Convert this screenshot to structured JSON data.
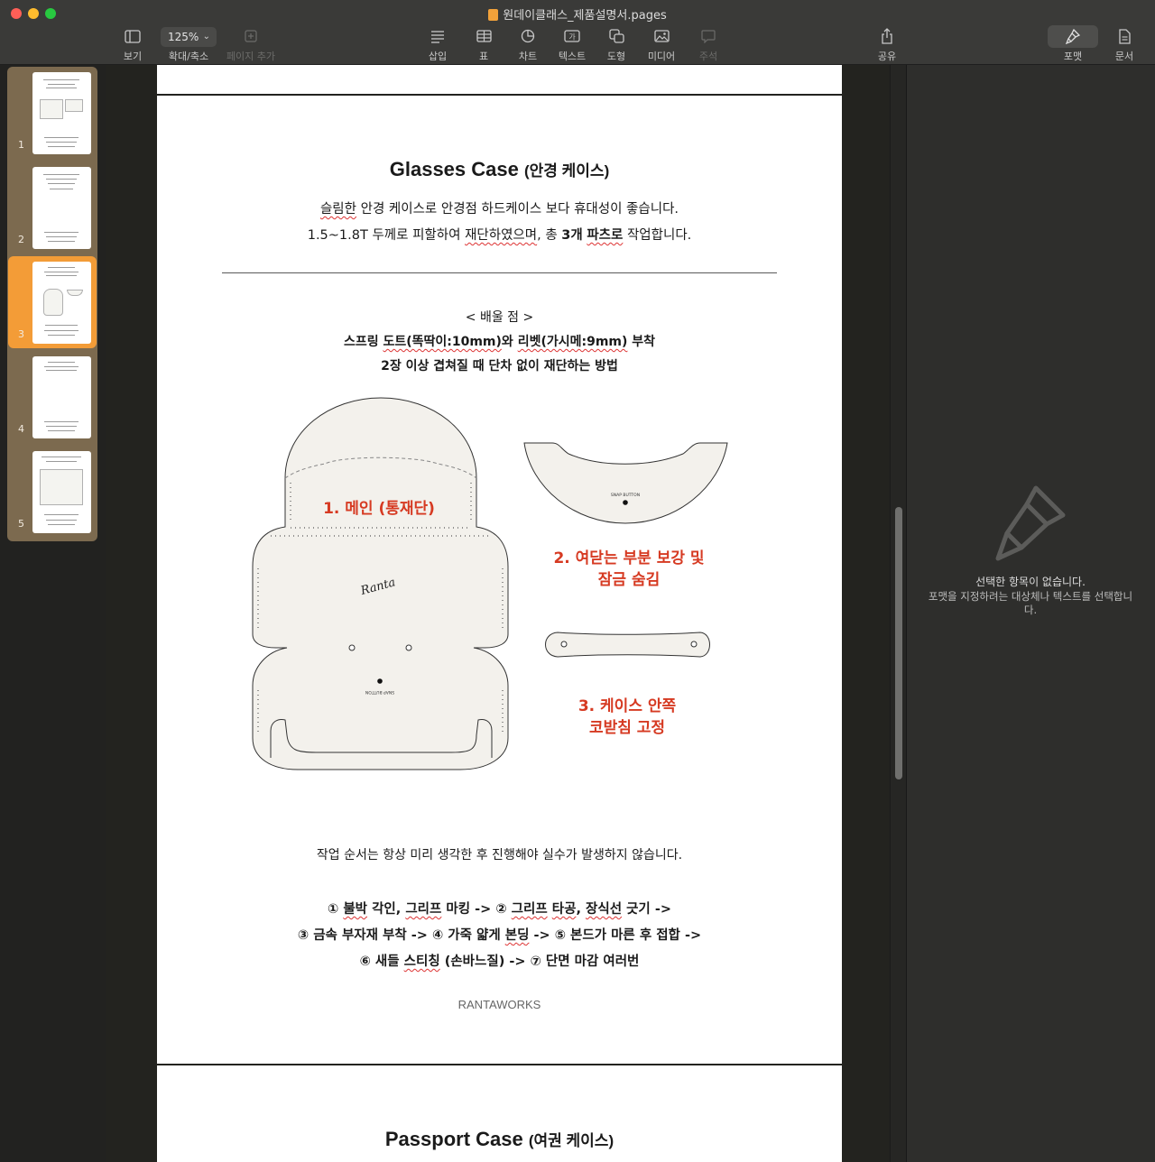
{
  "window": {
    "title": "원데이클래스_제품설명서.pages"
  },
  "toolbar": {
    "view_label": "보기",
    "zoom_value": "125%",
    "zoom_label": "확대/축소",
    "add_page_label": "페이지 추가",
    "insert_label": "삽입",
    "table_label": "표",
    "chart_label": "차트",
    "text_label": "텍스트",
    "shape_label": "도형",
    "media_label": "미디어",
    "comment_label": "주석",
    "share_label": "공유",
    "format_label": "포맷",
    "document_label": "문서"
  },
  "sidebar": {
    "pages": [
      {
        "number": "1"
      },
      {
        "number": "2"
      },
      {
        "number": "3",
        "selected": true
      },
      {
        "number": "4"
      },
      {
        "number": "5"
      }
    ]
  },
  "inspector": {
    "title": "선택한 항목이 없습니다.",
    "subtitle": "포맷을 지정하려는 대상체나 텍스트를 선택합니다."
  },
  "document": {
    "title_en": "Glasses Case",
    "title_ko": "(안경 케이스)",
    "intro_line1_parts": [
      "",
      "슬림한",
      " 안경 케이스로 안경점 하드케이스 보다 휴대성이 좋습니다."
    ],
    "intro_line2_parts": [
      "1.5~1.8T 두께로 피할하여 ",
      "재단하였으며",
      ", 총 ",
      "3개",
      " ",
      "파츠로",
      " 작업합니다."
    ],
    "learn_heading": "< 배울 점 >",
    "learn_line1_parts": [
      "스프링 ",
      "도트(똑딱이:10mm)",
      "와 ",
      "리벳(가시메:9mm)",
      " 부착"
    ],
    "learn_line2": "2장 이상 겹쳐질 때 단차 없이 재단하는 방법",
    "callouts": {
      "main": "1. 메인 (통재단)",
      "reinforce_line1": "2. 여닫는 부분 보강 및",
      "reinforce_line2": "잠금 숨김",
      "nose_line1": "3. 케이스 안쪽",
      "nose_line2": "코받침 고정"
    },
    "pattern_labels": {
      "snap_button": "SNAP BUTTON",
      "logo": "Ranta"
    },
    "order_note": "작업 순서는 항상 미리 생각한 후 진행해야 실수가 발생하지 않습니다.",
    "steps_line1_parts": [
      "① ",
      "불박",
      " 각인, ",
      "그리프",
      " 마킹 -> ② ",
      "그리프",
      " ",
      "타공",
      ", ",
      "장식선",
      " 긋기 ->"
    ],
    "steps_line2_parts": [
      "③ 금속 부자재 부착 -> ④ 가죽 얇게 ",
      "본딩",
      " -> ⑤ 본드가 마른 후 접합 ->"
    ],
    "steps_line3_parts": [
      "⑥ 새들 ",
      "스티칭",
      " (손바느질) -> ⑦ 단면 마감 여러번"
    ],
    "brand": "RANTAWORKS",
    "next_title_en": "Passport Case",
    "next_title_ko": "(여권 케이스)"
  },
  "colors": {
    "accent_red": "#d63a22",
    "selection_orange": "#f39c37",
    "toolbar_bg": "#3a3a38"
  }
}
